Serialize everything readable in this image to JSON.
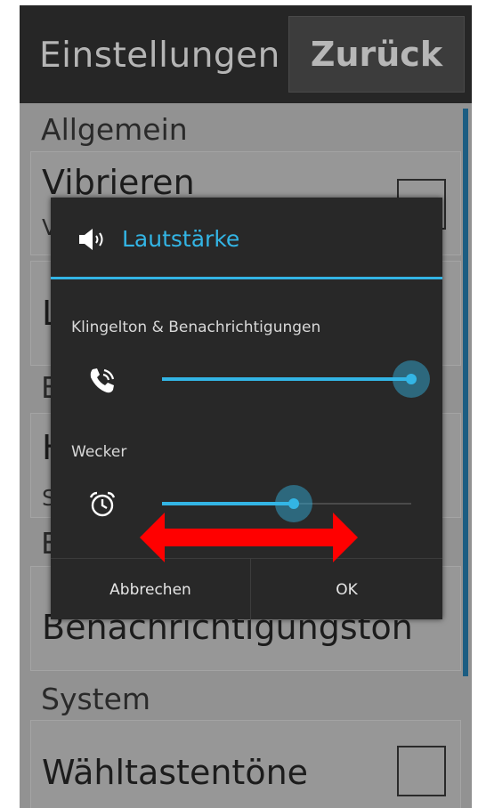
{
  "app": {
    "title": "Einstellungen",
    "back_label": "Zurück"
  },
  "sections": {
    "general_header": "Allgemein",
    "general_b_header": "E",
    "general_c_header": "E",
    "system_header": "System"
  },
  "prefs": {
    "vibrate_title": "Vibrieren",
    "vibrate_sub": "V",
    "vibrate_checked": false,
    "pref2_title": "L",
    "pref3_title": "H",
    "pref3_sub": "S",
    "notif_tone_title": "Benachrichtigungston",
    "dial_tones_title": "Wähltastentöne",
    "dial_tones_checked": false
  },
  "dialog": {
    "icon": "speaker-volume-icon",
    "title": "Lautstärke",
    "ringer_label": "Klingelton & Benachrichtigungen",
    "ringer_icon": "phone-ringing-icon",
    "ringer_level": 1.0,
    "alarm_label": "Wecker",
    "alarm_icon": "alarm-clock-icon",
    "alarm_level": 0.53,
    "cancel_label": "Abbrechen",
    "ok_label": "OK"
  },
  "annotation": {
    "icon": "double-headed-arrow-icon",
    "color": "#ff0000"
  },
  "colors": {
    "accent": "#33b5e5",
    "actionbar": "#262626",
    "dialog_bg": "#282828"
  }
}
